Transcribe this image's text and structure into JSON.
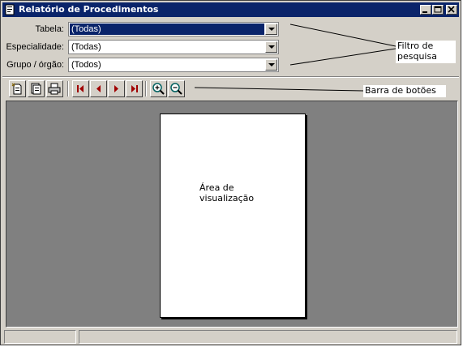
{
  "window": {
    "title": "Relatório de Procedimentos",
    "controls": [
      "minimize",
      "maximize",
      "close"
    ]
  },
  "filters": [
    {
      "label": "Tabela:",
      "value": "(Todas)",
      "selected": true
    },
    {
      "label": "Especialidade:",
      "value": "(Todas)",
      "selected": false
    },
    {
      "label": "Grupo / órgão:",
      "value": "(Todos)",
      "selected": false
    }
  ],
  "annotations": {
    "filter": {
      "line1": "Filtro de",
      "line2": "pesquisa"
    },
    "toolbar": {
      "text": "Barra de botões"
    },
    "preview": {
      "line1": "Área de",
      "line2": "visualização"
    }
  },
  "toolbar": {
    "buttons": [
      {
        "name": "new-report-icon",
        "group": 1
      },
      {
        "name": "setup-icon",
        "group": 1
      },
      {
        "name": "print-icon",
        "group": 1
      },
      {
        "name": "first-page-icon",
        "group": 2
      },
      {
        "name": "previous-page-icon",
        "group": 2
      },
      {
        "name": "next-page-icon",
        "group": 2
      },
      {
        "name": "last-page-icon",
        "group": 2
      },
      {
        "name": "zoom-in-icon",
        "group": 3
      },
      {
        "name": "zoom-out-icon",
        "group": 3
      }
    ],
    "nav_arrow_color": "#a00000",
    "zoom_color": "#006060"
  },
  "colors": {
    "titlebar": "#0a246a",
    "face": "#d4d0c8",
    "preview_bg": "#808080",
    "selection": "#0a246a"
  }
}
